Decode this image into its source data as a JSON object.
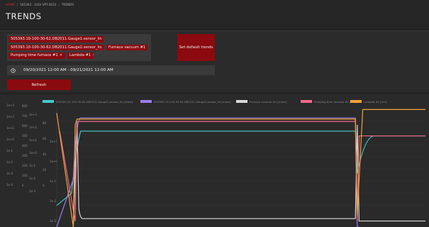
{
  "breadcrumb": {
    "items": [
      "HOME",
      "505393 - 10LV VPT-4033",
      "TRENDS"
    ]
  },
  "page": {
    "title": "TRENDS"
  },
  "filters": {
    "chips": [
      {
        "label": "505393.10-100-30-62.DB2011.Gauge1.sensor_lin",
        "remove": "×"
      },
      {
        "label": "505393.10-100-30-62.DB2011.Gauge2.sensor_lin",
        "remove": "×"
      },
      {
        "label": "Furnace vacuum #1",
        "remove": "×"
      },
      {
        "label": "Pumping time furnace #1",
        "remove": "×"
      },
      {
        "label": "Lambda #1",
        "remove": "×"
      }
    ],
    "default_trends_label": "Set default trends",
    "date_range": "09/20/2021 12:00 AM - 09/21/2021 12:00 AM",
    "refresh_label": "Refresh"
  },
  "chart_data": {
    "type": "line",
    "legend_position": "top",
    "series": [
      {
        "name": "505393.10-100-30-62.DB2011.Gauge1.sensor_lin [mbar]",
        "color": "#48c9c9"
      },
      {
        "name": "505393.10-100-30-62.DB2011.Gauge2.sensor_lin [mbar]",
        "color": "#9c7cf0"
      },
      {
        "name": "Furnace vacuum #1 [mbar]",
        "color": "#d8d8d8"
      },
      {
        "name": "Pumping time furnace #1 [sec]",
        "color": "#f06b8a"
      },
      {
        "name": "Lambda #1 [mV]",
        "color": "#f3a23a"
      }
    ],
    "y_axes": [
      {
        "ticks": [
          "1e+3",
          "1e+2",
          "1e+1",
          "1e+0",
          "1e-1",
          "1e-2",
          "1e-3",
          "1e-4"
        ]
      },
      {
        "ticks": [
          "800",
          "700",
          "600",
          "500",
          "400",
          "300",
          "200",
          "100",
          "0"
        ]
      },
      {
        "ticks": [
          "1e+3",
          "1e+2",
          "1e+1",
          "1e+0",
          "1e-1",
          "1e-2",
          "1e-3"
        ]
      },
      {
        "ticks": [
          "80",
          "60",
          "40",
          "20",
          "0"
        ]
      },
      {
        "ticks": [
          "1e+1",
          "1e+0",
          "1e-1",
          "1e-2",
          "1e-3"
        ]
      }
    ]
  },
  "icons": {
    "clock": "clock-icon"
  },
  "colors": {
    "accent": "#8b0a0f",
    "home_link": "#c62828"
  }
}
